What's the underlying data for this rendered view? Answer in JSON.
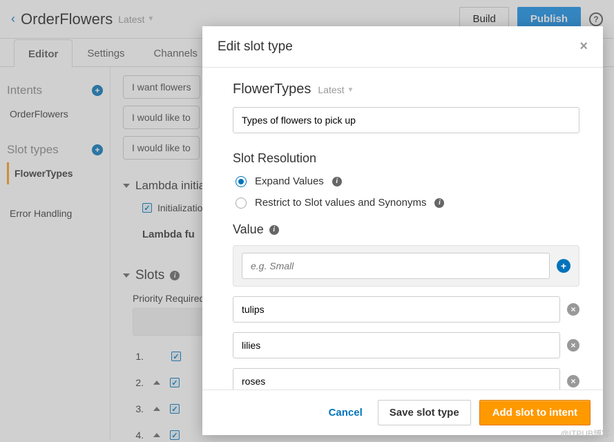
{
  "header": {
    "back_caret": "‹",
    "title": "OrderFlowers",
    "version": "Latest",
    "build": "Build",
    "publish": "Publish"
  },
  "tabs": {
    "editor": "Editor",
    "settings": "Settings",
    "channels": "Channels"
  },
  "sidebar": {
    "intents_label": "Intents",
    "intents": [
      {
        "label": "OrderFlowers"
      }
    ],
    "slot_types_label": "Slot types",
    "slot_types": [
      {
        "label": "FlowerTypes"
      }
    ],
    "error_handling": "Error Handling"
  },
  "content": {
    "utterances": [
      "I want flowers",
      "I would like to",
      "I would like to"
    ],
    "lambda_section": "Lambda initialization",
    "lambda_init_check": "Initialization",
    "lambda_fun": "Lambda fu",
    "slots_label": "Slots",
    "priority_label": "Priority Required",
    "rows": [
      "1.",
      "2.",
      "3.",
      "4."
    ]
  },
  "modal": {
    "title": "Edit slot type",
    "slot_name": "FlowerTypes",
    "slot_version": "Latest",
    "description": "Types of flowers to pick up",
    "resolution_label": "Slot Resolution",
    "resolution_expand": "Expand Values",
    "resolution_restrict": "Restrict to Slot values and Synonyms",
    "value_label": "Value",
    "value_placeholder": "e.g. Small",
    "values": [
      "tulips",
      "lilies",
      "roses"
    ],
    "cancel": "Cancel",
    "save": "Save slot type",
    "add": "Add slot to intent"
  },
  "watermark": "@ITPUB博客"
}
